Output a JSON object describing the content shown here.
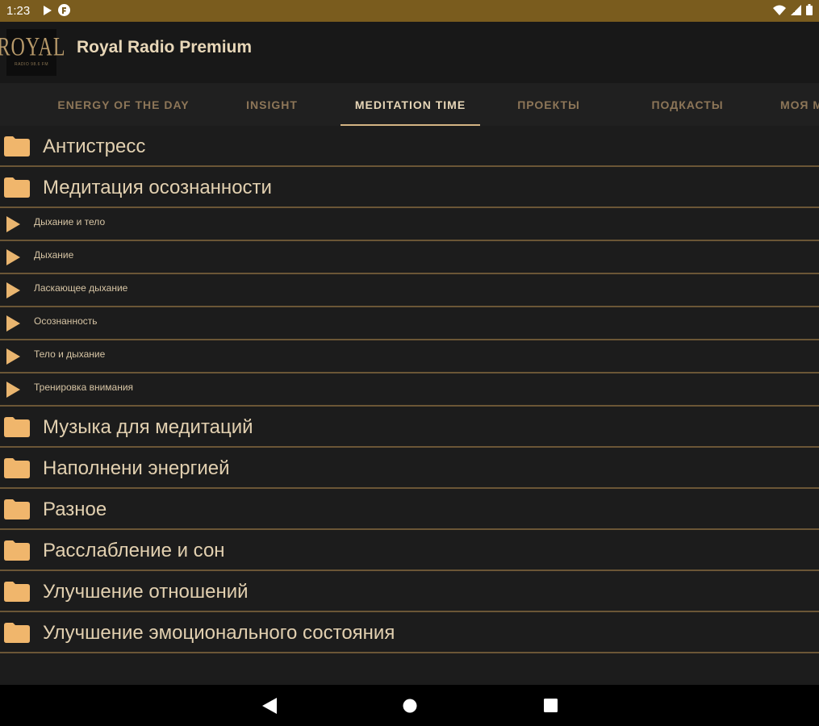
{
  "status_bar": {
    "time": "1:23",
    "icons_left": [
      "play-icon",
      "notification-icon"
    ],
    "icons_right": [
      "wifi-icon",
      "signal-icon",
      "battery-icon"
    ]
  },
  "app_bar": {
    "logo_text": "ROYAL",
    "logo_subtext": "RADIO 98.6 FM",
    "title": "Royal Radio Premium"
  },
  "tabs": [
    {
      "label": "ENERGY OF THE DAY",
      "active": false
    },
    {
      "label": "INSIGHT",
      "active": false
    },
    {
      "label": "MEDITATION TIME",
      "active": true
    },
    {
      "label": "ПРОЕКТЫ",
      "active": false
    },
    {
      "label": "ПОДКАСТЫ",
      "active": false
    },
    {
      "label": "МОЯ М",
      "active": false
    }
  ],
  "list": [
    {
      "type": "folder",
      "label": "Антистресс"
    },
    {
      "type": "folder",
      "label": "Медитация осознанности"
    },
    {
      "type": "track",
      "label": "Дыхание и тело"
    },
    {
      "type": "track",
      "label": "Дыхание"
    },
    {
      "type": "track",
      "label": "Ласкающее дыхание"
    },
    {
      "type": "track",
      "label": "Осознанность"
    },
    {
      "type": "track",
      "label": "Тело и дыхание"
    },
    {
      "type": "track",
      "label": "Тренировка внимания"
    },
    {
      "type": "folder",
      "label": "Музыка для медитаций"
    },
    {
      "type": "folder",
      "label": "Наполнени энергией"
    },
    {
      "type": "folder",
      "label": "Разное"
    },
    {
      "type": "folder",
      "label": "Расслабление и сон"
    },
    {
      "type": "folder",
      "label": "Улучшение отношений"
    },
    {
      "type": "folder",
      "label": "Улучшение эмоционального состояния"
    }
  ],
  "nav_bar": {
    "buttons": [
      "back-icon",
      "home-icon",
      "recents-icon"
    ]
  },
  "colors": {
    "status_bar": "#7a5c1e",
    "accent": "#d4b483",
    "folder": "#f0b66c",
    "divider": "#6b5636",
    "background": "#1c1c1c"
  }
}
